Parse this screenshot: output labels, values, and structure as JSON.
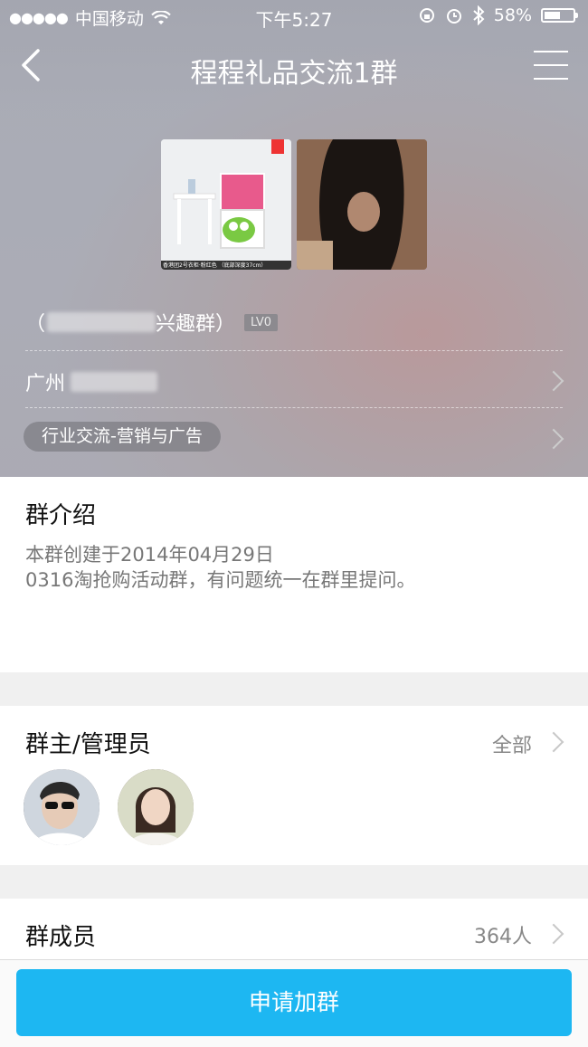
{
  "status_bar": {
    "signal_dots": "●●●●●",
    "carrier": "中国移动",
    "time": "下午5:27",
    "battery_text": "58%",
    "battery_level": 0.58
  },
  "nav": {
    "title": "程程礼品交流1群",
    "back_icon": "chevron-left-icon",
    "menu_icon": "hamburger-menu-icon"
  },
  "photos": {
    "p1_caption": "香港团2号衣柜·粉红色  （底部深度37cm）"
  },
  "group": {
    "name_visible": "兴趣群）",
    "name_prefix": "（",
    "level": "LV0",
    "location": "广州",
    "category": "行业交流-营销与广告"
  },
  "intro": {
    "title": "群介绍",
    "line1": "本群创建于2014年04月29日",
    "line2": "0316淘抢购活动群，有问题统一在群里提问。"
  },
  "admins": {
    "title": "群主/管理员",
    "all_link": "全部"
  },
  "members": {
    "title": "群成员",
    "count": "364人"
  },
  "apply": {
    "button": "申请加群"
  },
  "colors": {
    "accent": "#1db7f2",
    "text_primary": "#111111",
    "text_secondary": "#777777"
  }
}
